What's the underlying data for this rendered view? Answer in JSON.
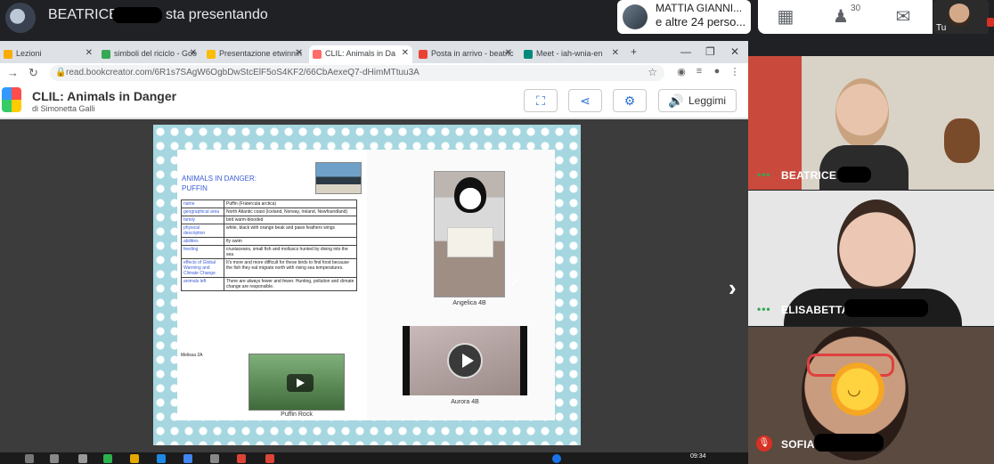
{
  "meet": {
    "presenter_name": "BEATRICE",
    "presenting_text": "sta presentando",
    "participants_line1": "MATTIA GIANNI...",
    "participants_line2": "e altre 24 perso...",
    "participants_count": "30",
    "self_label": "Tu"
  },
  "browser": {
    "tabs": [
      {
        "label": "Lezioni",
        "favicon_color": "#f9ab00"
      },
      {
        "label": "simboli del riciclo - Goo",
        "favicon_color": "#34a853"
      },
      {
        "label": "Presentazione etwinnin",
        "favicon_color": "#fbbc04"
      },
      {
        "label": "CLIL: Animals in Da",
        "favicon_color": "#ff6b6b"
      },
      {
        "label": "Posta in arrivo - beatric",
        "favicon_color": "#ea4335"
      },
      {
        "label": "Meet - iah-wnia-en",
        "favicon_color": "#00897b"
      }
    ],
    "url": "read.bookcreator.com/6R1s7SAgW6OgbDwStcElF5oS4KF2/66CbAexeQ7-dHimMTtuu3A"
  },
  "book": {
    "title": "CLIL: Animals in Danger",
    "author": "di Simonetta Galli",
    "read_button": "Leggimi",
    "page_title_line1": "ANIMALS IN DANGER:",
    "page_title_line2": "PUFFIN",
    "table": [
      {
        "key": "name",
        "value": "Puffin (Fratercula arctica)"
      },
      {
        "key": "geographical area",
        "value": "North Atlantic coast (Iceland, Norway, Ireland, Newfoundland)"
      },
      {
        "key": "family",
        "value": "bird warm-blooded"
      },
      {
        "key": "physical description",
        "value": "white, black with orange beak and paws feathers wings"
      },
      {
        "key": "abilities",
        "value": "fly swim"
      },
      {
        "key": "feeding",
        "value": "crustaceans, small fish and molluscs hunted by diving into the sea"
      },
      {
        "key": "effects of Global Warming and Climate Change",
        "value": "It's more and more difficult for these birds to find food because the fish they eat migrate north with rising sea temperatures."
      },
      {
        "key": "animals left",
        "value": "There are always fewer and fewer. Hunting, pollution and climate change are responsible."
      }
    ],
    "melissa_label": "Melissa 2A",
    "video_left_caption": "Puffin Rock",
    "photo_right_caption": "Angelica 4B",
    "video_right_caption": "Aurora 4B"
  },
  "taskbar": {
    "time": "09:34"
  },
  "participants": [
    {
      "name": "BEATRICE"
    },
    {
      "name": "ELISABETTA"
    },
    {
      "name": "SOFIA"
    }
  ]
}
